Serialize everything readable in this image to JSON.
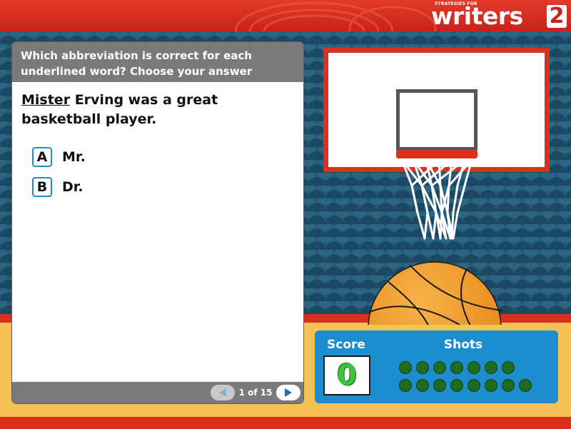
{
  "banner": {
    "logo_small": "STRATEGIES FOR",
    "logo_word": "writers",
    "logo_number": "2"
  },
  "question_panel": {
    "instructions": "Which abbreviation is correct for each underlined word? Choose your answer below.",
    "question_underlined": "Mister",
    "question_rest": " Erving was a great basketball player.",
    "answers": [
      {
        "letter": "A",
        "text": "Mr."
      },
      {
        "letter": "B",
        "text": "Dr."
      }
    ],
    "pagination": {
      "label": "1 of 15",
      "current": 1,
      "total": 15
    }
  },
  "scoreboard": {
    "score_label": "Score",
    "score_value": "0",
    "shots_label": "Shots",
    "shots_total": 15,
    "shots_taken": 0
  },
  "colors": {
    "banner_red": "#d8321f",
    "answer_border": "#1d90c8",
    "score_panel": "#1c8ed0",
    "score_digit": "#3ec33e",
    "shot_dot": "#1f6b1f",
    "floor": "#f6c258",
    "ball": "#f29a1f"
  },
  "icons": {
    "prev": "triangle-left-icon",
    "next": "triangle-right-icon"
  }
}
